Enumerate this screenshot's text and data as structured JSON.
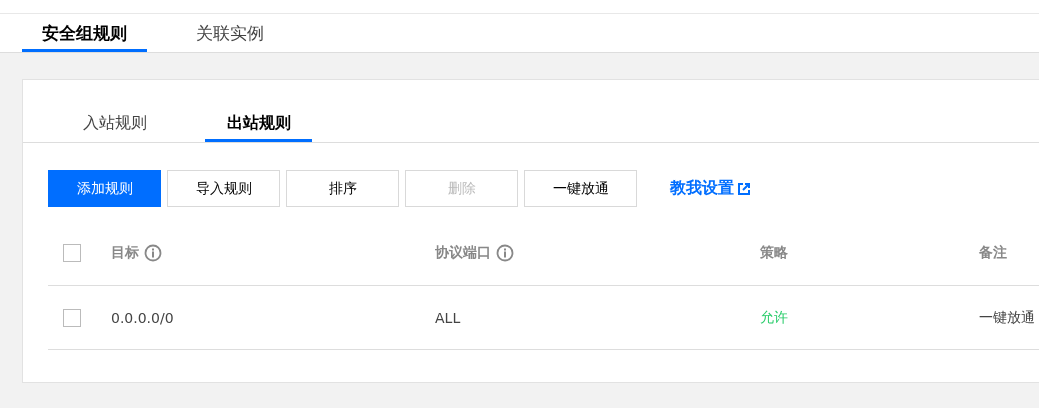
{
  "top_tabs": [
    {
      "label": "安全组规则",
      "selected": true
    },
    {
      "label": "关联实例",
      "selected": false
    }
  ],
  "rule_tabs": [
    {
      "label": "入站规则",
      "selected": false
    },
    {
      "label": "出站规则",
      "selected": true
    }
  ],
  "toolbar": {
    "buttons": [
      {
        "label": "添加规则",
        "kind": "primary",
        "disabled": false
      },
      {
        "label": "导入规则",
        "kind": "default",
        "disabled": false
      },
      {
        "label": "排序",
        "kind": "default",
        "disabled": false
      },
      {
        "label": "删除",
        "kind": "default",
        "disabled": true
      },
      {
        "label": "一键放通",
        "kind": "default",
        "disabled": false
      }
    ],
    "help_link": "教我设置"
  },
  "table": {
    "all_checked": false,
    "columns": [
      {
        "label": "目标",
        "info": true
      },
      {
        "label": "协议端口",
        "info": true
      },
      {
        "label": "策略",
        "info": false
      },
      {
        "label": "备注",
        "info": false
      }
    ],
    "rows": [
      {
        "checked": false,
        "target": "0.0.0.0/0",
        "port": "ALL",
        "policy": "允许",
        "color": "#29cc6a",
        "note": "一键放通"
      }
    ]
  }
}
